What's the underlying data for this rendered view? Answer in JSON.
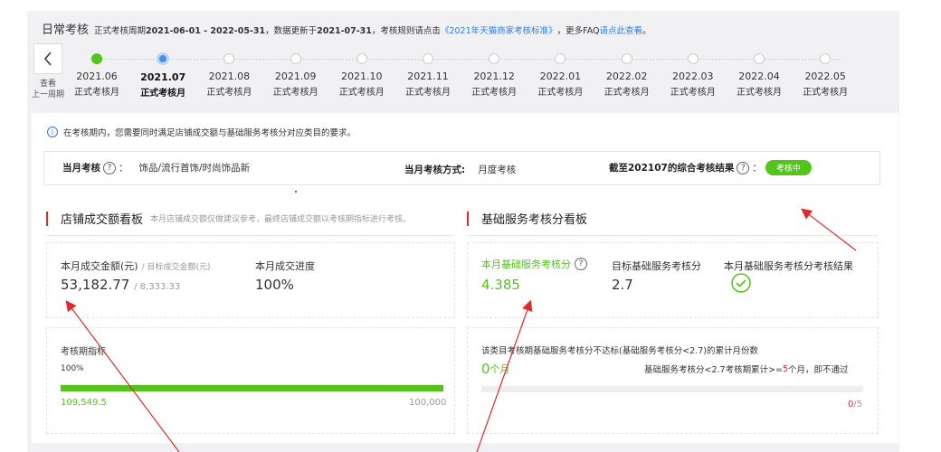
{
  "header": {
    "title": "日常考核",
    "period_prefix": "正式考核周期",
    "period": "2021-06-01 - 2022-05-31",
    "update_prefix": "，数据更新于",
    "update_date": "2021-07-31",
    "rule_prefix": "，考核规则请点击",
    "rule_link": "《2021年天猫商家考核标准》",
    "faq_prefix": "，更多FAQ",
    "faq_link": "请点此查看",
    "end": "。"
  },
  "nav": {
    "prev_label_1": "查看",
    "prev_label_2": "上一周期"
  },
  "months": [
    {
      "date": "2021.06",
      "type": "正式考核月",
      "state": "done"
    },
    {
      "date": "2021.07",
      "type": "正式考核月",
      "state": "current"
    },
    {
      "date": "2021.08",
      "type": "正式考核月",
      "state": "future"
    },
    {
      "date": "2021.09",
      "type": "正式考核月",
      "state": "future"
    },
    {
      "date": "2021.10",
      "type": "正式考核月",
      "state": "future"
    },
    {
      "date": "2021.11",
      "type": "正式考核月",
      "state": "future"
    },
    {
      "date": "2021.12",
      "type": "正式考核月",
      "state": "future"
    },
    {
      "date": "2022.01",
      "type": "正式考核月",
      "state": "future"
    },
    {
      "date": "2022.02",
      "type": "正式考核月",
      "state": "future"
    },
    {
      "date": "2022.03",
      "type": "正式考核月",
      "state": "future"
    },
    {
      "date": "2022.04",
      "type": "正式考核月",
      "state": "future"
    },
    {
      "date": "2022.05",
      "type": "正式考核月",
      "state": "future"
    }
  ],
  "info": {
    "icon": "info-icon",
    "text": "在考核期内，您需要同时满足店铺成交额与基础服务考核分对应类目的要求。"
  },
  "summary": {
    "month_label": "当月考核",
    "month_colon": "：",
    "category": "饰品/流行首饰/时尚饰品新",
    "method_label": "当月考核方式:",
    "method_value": "月度考核",
    "result_label": "截至202107的综合考核结果",
    "result_colon": "：",
    "result_badge": "考核中"
  },
  "sales": {
    "title": "店铺成交额看板",
    "note": "本月店铺成交额仅做建议参考，最终店铺成交额以考核期指标进行考核。",
    "amount_label": "本月成交金额(元)",
    "target_label": "/ 目标成交金额(元)",
    "amount_value": "53,182.77",
    "target_value": "/ 8,333.33",
    "progress_label": "本月成交进度",
    "progress_value": "100%",
    "period_label": "考核期指标",
    "period_percent_text": "100%",
    "period_fill": 1.0,
    "period_current": "109,549.5",
    "period_target": "100,000"
  },
  "service": {
    "title": "基础服务考核分看板",
    "score_label": "本月基础服务考核分",
    "score_value": "4.385",
    "target_label": "目标基础服务考核分",
    "target_value": "2.7",
    "result_label": "本月基础服务考核分考核结果",
    "result_icon": "check-circle-icon",
    "fail_title": "该类目考核期基础服务考核分不达标(基础服务考核分<2.7)的累计月份数",
    "fail_count": "0",
    "fail_unit": "个月",
    "fail_rule_prefix": "基础服务考核分<2.7考核期累计>=",
    "fail_rule_num": "5",
    "fail_rule_suffix": "个月，即不通过",
    "fail_fill": 0.0,
    "fail_current": "0",
    "fail_total": "/5"
  },
  "colors": {
    "accent_green": "#52c41a",
    "accent_blue": "#2b7de9",
    "accent_red": "#e0292f"
  }
}
